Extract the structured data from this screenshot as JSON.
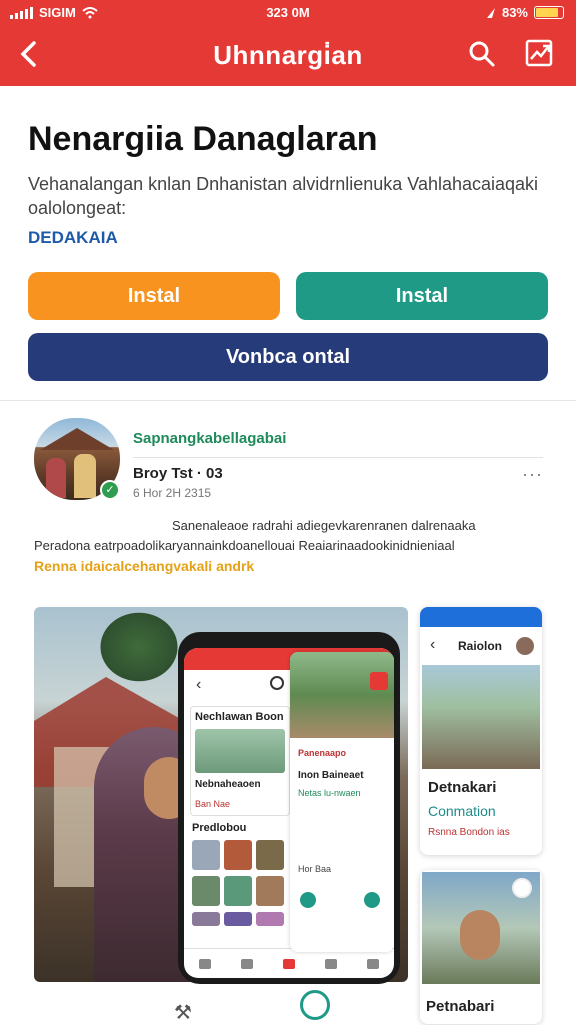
{
  "status_bar": {
    "carrier": "SIGIM",
    "time": "323 0M",
    "battery": "83%",
    "battery_level": 0.83
  },
  "app_bar": {
    "title": "Uhnnargi̇an"
  },
  "hero": {
    "title": "Nenargiia Danaglaran",
    "description": "Vehanalangan knlan Dnhanistan alvidrnlienuka Vahlahacaiaqaki oalolongeat:",
    "developer": "DEDAKAIA"
  },
  "buttons": {
    "install_orange": "Instal",
    "install_teal": "Instal",
    "navy": "Vonbca ontal"
  },
  "post": {
    "author": "Sapnangkabellagabai",
    "title": "Broy Tst · 03",
    "date": "6  Hor 2H 2315",
    "more": "···",
    "body_line1": "Sanenaleaoe radrahi adiegevkarenranen dalrenaaka",
    "body_line2": "Peradona eatrpoadolikaryannainkdoanellouai Reaiarinaadookinidnieniaal",
    "tag": "Renna idaicalcehangvakali andrk"
  },
  "phone_screen": {
    "card_title": "Nechlawan Boon",
    "card_sub": "Nebnaheaoen",
    "card_meta": "Ban           Nae",
    "section": "Predlobou",
    "panel_label": "Panenaapo",
    "panel_title": "Inon Baineaet",
    "panel_sub": "Netas lu-nwaen",
    "panel_meta": "Hor             Baa"
  },
  "right_cards": {
    "card1_title": "Raiolon",
    "card1_name": "Detnakari",
    "card1_sub": "Conmation",
    "card1_meta": "Rsnna Bondon    ias",
    "card2_name": "Petnabari"
  }
}
